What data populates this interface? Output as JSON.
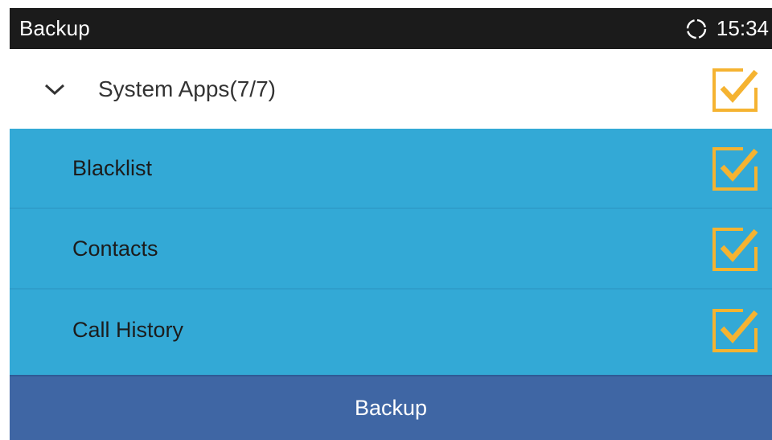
{
  "statusbar": {
    "title": "Backup",
    "sync_icon": "sync-icon",
    "time": "15:34"
  },
  "group": {
    "label": "System Apps(7/7)",
    "expanded": true,
    "checked": true,
    "chevron_icon": "chevron-down-icon"
  },
  "items": [
    {
      "label": "Blacklist",
      "checked": true
    },
    {
      "label": "Contacts",
      "checked": true
    },
    {
      "label": "Call History",
      "checked": true
    }
  ],
  "footer": {
    "backup_label": "Backup"
  },
  "colors": {
    "statusbar_bg": "#1b1b1b",
    "list_bg": "#33a9d6",
    "button_bg": "#3f66a4",
    "checkbox_accent": "#f5b331"
  }
}
